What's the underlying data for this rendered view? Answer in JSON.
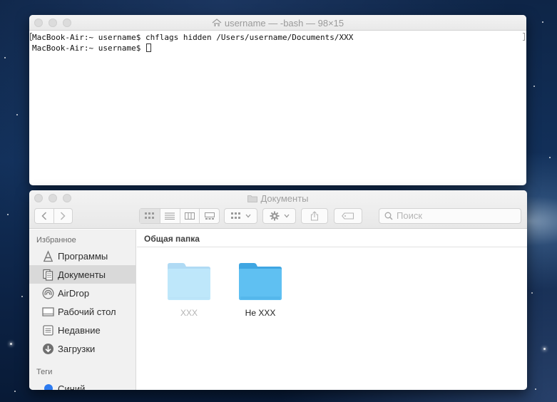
{
  "terminal": {
    "title": "username — -bash — 98×15",
    "lines": [
      "MacBook-Air:~ username$ chflags hidden /Users/username/Documents/XXX",
      "MacBook-Air:~ username$ "
    ]
  },
  "finder": {
    "title": "Документы",
    "search_placeholder": "Поиск",
    "sidebar": {
      "favorites_heading": "Избранное",
      "items": [
        {
          "label": "Программы",
          "icon": "applications-icon"
        },
        {
          "label": "Документы",
          "icon": "documents-icon",
          "selected": true
        },
        {
          "label": "AirDrop",
          "icon": "airdrop-icon"
        },
        {
          "label": "Рабочий стол",
          "icon": "desktop-icon"
        },
        {
          "label": "Недавние",
          "icon": "recents-icon"
        },
        {
          "label": "Загрузки",
          "icon": "downloads-icon"
        }
      ],
      "tags_heading": "Теги",
      "tags": [
        {
          "label": "Синий",
          "color": "#2d7bf0"
        }
      ]
    },
    "path_bar": "Общая папка",
    "files": [
      {
        "name": "XXX",
        "hidden": true
      },
      {
        "name": "Не XXX",
        "hidden": false
      }
    ]
  },
  "colors": {
    "folder_blue": "#5fc0f2",
    "hidden_label": "#b4b4b4"
  }
}
